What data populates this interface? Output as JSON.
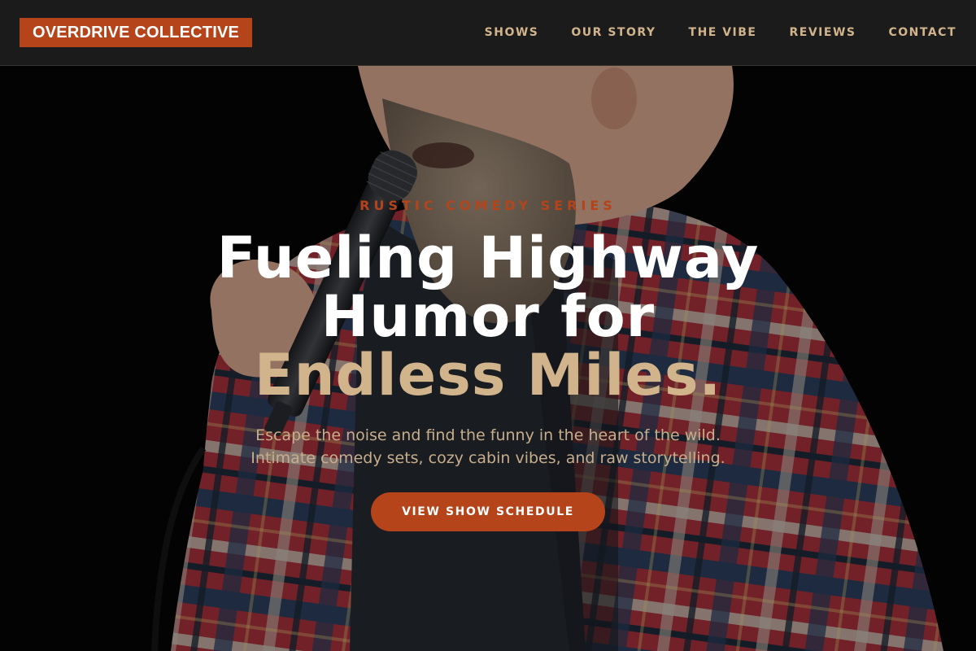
{
  "header": {
    "logo": "OVERDRIVE COLLECTIVE",
    "nav": [
      "SHOWS",
      "OUR STORY",
      "THE VIBE",
      "REVIEWS",
      "CONTACT"
    ]
  },
  "hero": {
    "image_subject": "bearded comedian in red plaid flannel shirt holding a microphone",
    "eyebrow": "RUSTIC COMEDY SERIES",
    "headline_line1": "Fueling Highway",
    "headline_line2": "Humor for",
    "headline_accent": "Endless Miles.",
    "subtext_line1": "Escape the noise and find the funny in the heart of the wild.",
    "subtext_line2": "Intimate comedy sets, cozy cabin vibes, and raw storytelling.",
    "cta_label": "VIEW SHOW SCHEDULE"
  },
  "colors": {
    "accent": "#b5441a",
    "tan": "#d2b48c",
    "header_bg": "#1b1b1b"
  }
}
